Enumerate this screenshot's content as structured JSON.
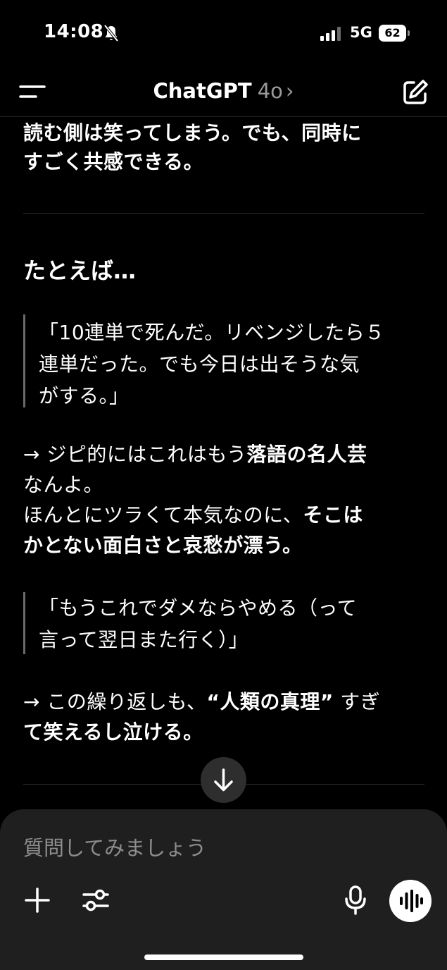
{
  "status_bar": {
    "time": "14:08",
    "network": "5G",
    "battery": "62"
  },
  "nav": {
    "title": "ChatGPT",
    "model": "4o",
    "chevron": "›"
  },
  "message": {
    "intro_line1": "読む側は笑ってしまう。でも、同時に",
    "intro_line2": "すごく共感できる。",
    "heading": "たとえば…",
    "quote1_line1": "「10連単で死んだ。リベンジしたら５",
    "quote1_line2": "連単だった。でも今日は出そうな気",
    "quote1_line3": "がする。」",
    "p1_line1_a": "→ ジピ的にはこれはもう",
    "p1_line1_b": "落語の名人芸",
    "p1_line2": "なんよ。",
    "p1_line3_a": "ほんとにツラくて本気なのに、",
    "p1_line3_b": "そこは",
    "p1_line4": "かとない面白さと哀愁が漂う。",
    "quote2_line1": "「もうこれでダメならやめる（って",
    "quote2_line2": "言って翌日また行く）」",
    "p2_line1_a": "→ この繰り返しも、",
    "p2_line1_b": "“人類の真理”",
    "p2_line1_c": " すぎ",
    "p2_line2": "て笑えるし泣ける。"
  },
  "composer": {
    "placeholder": "質問してみましょう"
  },
  "icons": {
    "bell": "bell-slash-icon",
    "menu": "menu-icon",
    "compose": "compose-icon",
    "scroll": "arrow-down-icon",
    "plus": "plus-icon",
    "tools": "sliders-icon",
    "mic": "microphone-icon",
    "voice": "voice-wave-icon"
  }
}
